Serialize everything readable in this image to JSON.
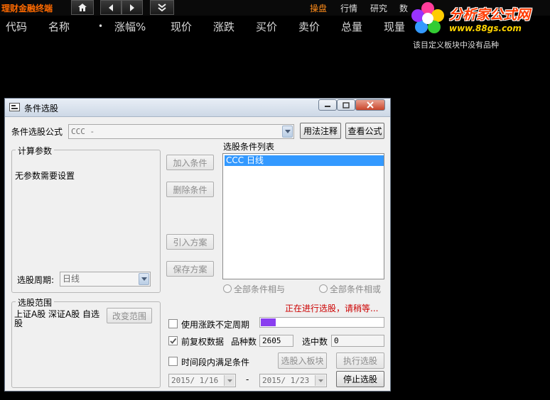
{
  "topbar": {
    "app_title": "理财金融终端",
    "menu": [
      "操盘",
      "行情",
      "研究",
      "数"
    ]
  },
  "stock_header": {
    "columns": [
      "代码",
      "名称",
      "•",
      "涨幅%",
      "现价",
      "涨跌",
      "买价",
      "卖价",
      "总量",
      "现量"
    ]
  },
  "empty_message": "该目定义板块中没有品种",
  "watermark": {
    "brand": "分析家公式网",
    "url": "www.88gs.com"
  },
  "dialog": {
    "title": "条件选股",
    "formula_label": "条件选股公式",
    "formula_value": "CCC          -",
    "usage_button": "用法注释",
    "view_formula_button": "查看公式",
    "params_group": "计算参数",
    "params_text": "无参数需要设置",
    "period_label": "选股周期:",
    "period_value": "日线",
    "add_condition": "加入条件",
    "delete_condition": "删除条件",
    "import_plan": "引入方案",
    "save_plan": "保存方案",
    "list_label": "选股条件列表",
    "conditions": [
      "CCC   日线"
    ],
    "radio_and": "全部条件相与",
    "radio_or": "全部条件相或",
    "range_group": "选股范围",
    "range_text": "上证A股 深证A股 自选股",
    "change_range": "改变范围",
    "status": "正在进行选股，请稍等...",
    "progress": 0.12,
    "use_variable_period": "使用涨跌不定周期",
    "prior_adjust": "前复权数据",
    "prior_adjust_checked": true,
    "count_label": "品种数",
    "count_value": "2605",
    "selected_label": "选中数",
    "selected_value": "0",
    "time_range_label": "时间段内满足条件",
    "to_block_button": "选股入板块",
    "run_button": "执行选股",
    "stop_button": "停止选股",
    "date_from": "2015/ 1/16",
    "date_sep": "-",
    "date_to": "2015/ 1/23"
  },
  "colors": {
    "accent": "#ff8c1a",
    "selection": "#3399ff",
    "status_text": "#cc0000",
    "progress": "#8a3ff0"
  }
}
